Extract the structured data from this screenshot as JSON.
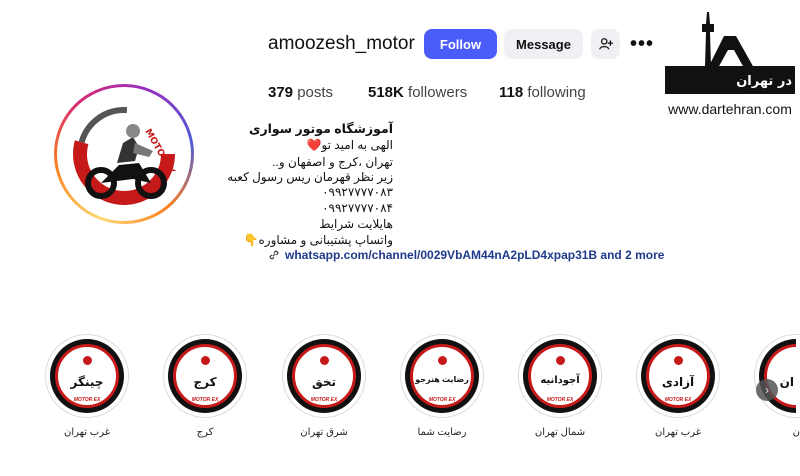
{
  "profile": {
    "username": "amoozesh_motor",
    "follow_label": "Follow",
    "message_label": "Message",
    "more_label": "•••",
    "stats": {
      "posts_count": "379",
      "posts_label": "posts",
      "followers_count": "518K",
      "followers_label": "followers",
      "following_count": "118",
      "following_label": "following"
    },
    "avatar_brand": "MOTOREX",
    "bio": {
      "name": "آموزشگاه موتور سواری",
      "lines": [
        "الهی به امید تو❤️",
        "تهران ،کرج و اصفهان و..",
        "زیر نظر قهرمان ریس رسول کعبه",
        "۰۹۹۲۷۷۷۷۰۸۳",
        "۰۹۹۲۷۷۷۷۰۸۴",
        "هایلایت شرایط",
        "واتساپ پشتیبانی و مشاوره👇"
      ],
      "link": "whatsapp.com/channel/0029VbAM44nA2pLD4xpap31B and 2 more"
    }
  },
  "watermark": {
    "text": "در تهران",
    "url": "www.dartehran.com"
  },
  "highlights": [
    {
      "title": "چینگر",
      "brand": "MOTOR EX",
      "label": "غرب تهران"
    },
    {
      "title": "کرج",
      "brand": "MOTOR EX",
      "label": "کرج"
    },
    {
      "title": "تخق",
      "brand": "MOTOR EX",
      "label": "شرق تهران"
    },
    {
      "title": "رضایت هنرجو",
      "brand": "MOTOR EX",
      "label": "رضایت شما"
    },
    {
      "title": "آجودانیه",
      "brand": "MOTOR EX",
      "label": "شمال تهران"
    },
    {
      "title": "آزادی",
      "brand": "MOTOR EX",
      "label": "غرب تهران"
    },
    {
      "title": "ان",
      "brand": "",
      "label": "ن"
    }
  ],
  "colors": {
    "follow_button": "#4a5df9",
    "secondary_button": "#eef0f3",
    "link": "#1f3a8a",
    "brand_red": "#c61a1a"
  }
}
